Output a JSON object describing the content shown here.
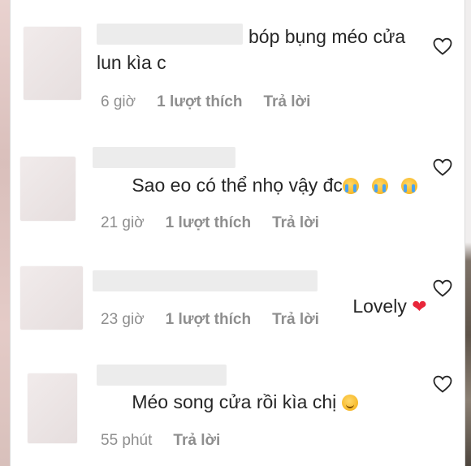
{
  "comments": [
    {
      "text": "bóp bụng méo cửa lun kìa c",
      "time": "6 giờ",
      "likes": "1 lượt thích",
      "reply": "Trả lời"
    },
    {
      "text": "Sao eo có thể nhọ vậy đc",
      "emoji": [
        "crying-face",
        "crying-face",
        "crying-face"
      ],
      "time": "21 giờ",
      "likes": "1 lượt thích",
      "reply": "Trả lời"
    },
    {
      "text": "Lovely",
      "emoji": [
        "red-heart"
      ],
      "time": "23 giờ",
      "likes": "1 lượt thích",
      "reply": "Trả lời"
    },
    {
      "text": "Méo song cửa rồi kìa chị",
      "emoji": [
        "smiling-face"
      ],
      "time": "55 phút",
      "reply": "Trả lời"
    }
  ],
  "icons": {
    "like": "heart-outline-icon"
  },
  "colors": {
    "text": "#262626",
    "meta": "#8e8e8e",
    "heart_emoji": "#e8263a"
  }
}
